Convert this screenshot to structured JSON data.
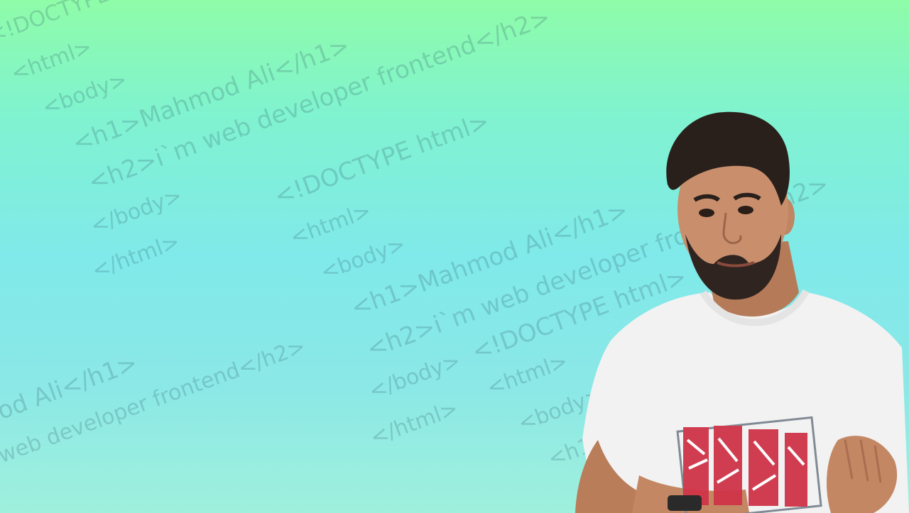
{
  "background": {
    "gradient_top": "#8ffca8",
    "gradient_mid": "#80e9ea",
    "gradient_bottom": "#9ff0dc",
    "code_text_color": "#285064"
  },
  "code_lines": [
    "<!DOCTYPE html>",
    "<html>",
    "<body>",
    "<h1>Mahmod Ali</h1>",
    "<h2>i`m web developer frontend</h2>",
    "</body>",
    "</html>",
    "<!DOCTYPE html>",
    "<html>",
    "<body>",
    "<h1>Mahmod Ali</h1>",
    "<h2>i`m web developer frontend</h2>",
    "<!DOCTYPE html>",
    "</body>",
    "<html>",
    "</html>",
    "<body>",
    "<h1>",
    "od Ali</h1>",
    "web developer frontend</h2>"
  ],
  "portrait": {
    "icon": "person-photo",
    "shirt_color": "#f2f2f2",
    "hair_color": "#2a201b",
    "skin_color": "#c98f6d",
    "print_color": "#d03448"
  }
}
